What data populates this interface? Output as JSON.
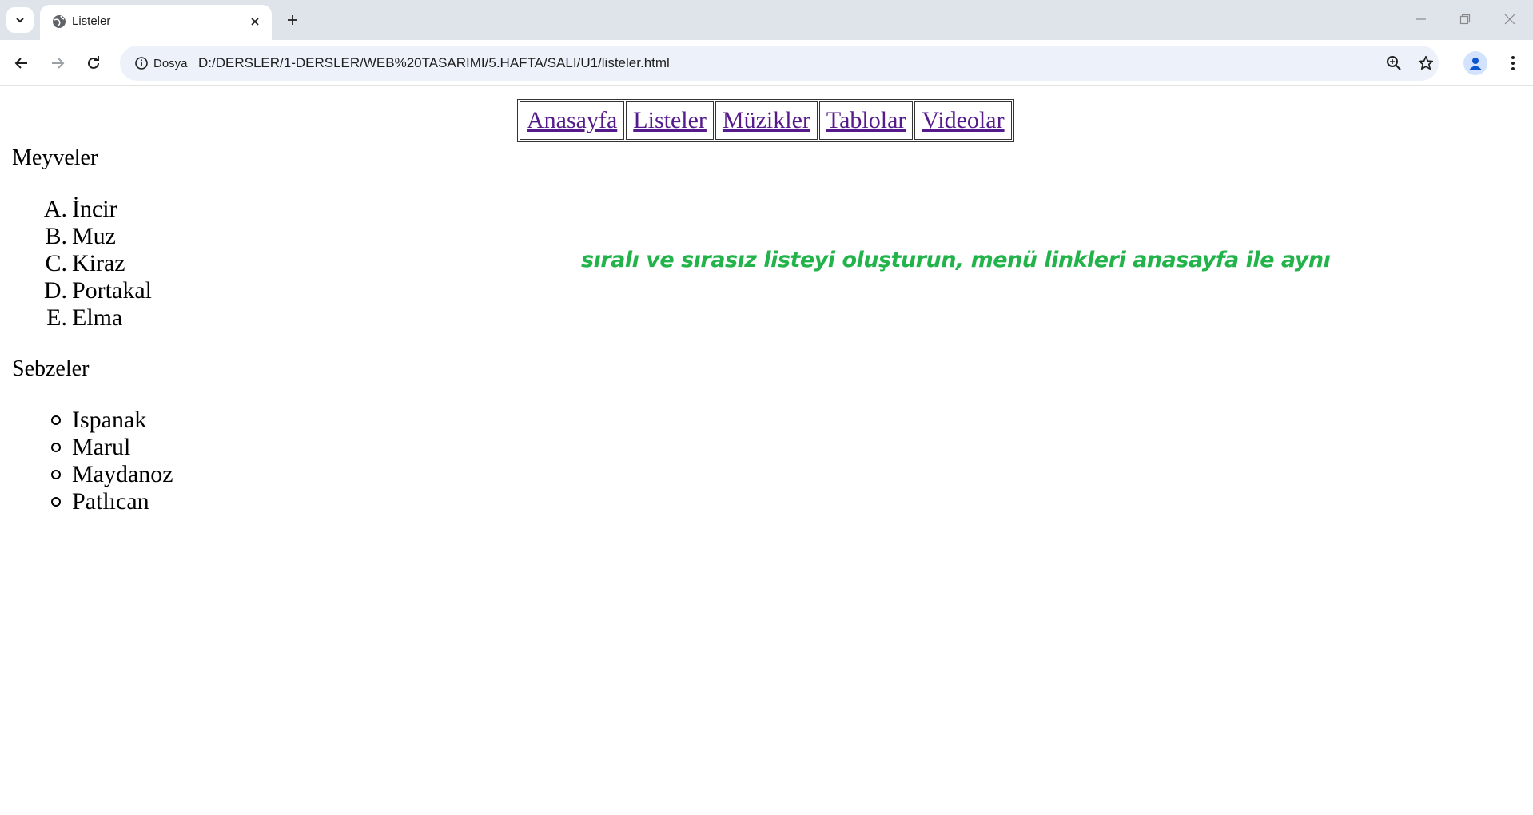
{
  "browser": {
    "tab_title": "Listeler",
    "site_info_label": "Dosya",
    "url": "D:/DERSLER/1-DERSLER/WEB%20TASARIMI/5.HAFTA/SALI/U1/listeler.html"
  },
  "page": {
    "menu": [
      "Anasayfa",
      "Listeler",
      "Müzikler",
      "Tablolar",
      "Videolar"
    ],
    "fruits": {
      "title": "Meyveler",
      "list_type": "ordered",
      "markers": [
        "A.",
        "B.",
        "C.",
        "D.",
        "E."
      ],
      "items": [
        "İncir",
        "Muz",
        "Kiraz",
        "Portakal",
        "Elma"
      ]
    },
    "vegetables": {
      "title": "Sebzeler",
      "list_type": "unordered-circle",
      "items": [
        "Ispanak",
        "Marul",
        "Maydanoz",
        "Patlıcan"
      ]
    },
    "note": "sıralı ve sırasız listeyi oluşturun, menü linkleri anasayfa ile aynı",
    "note_color": "#22b34b",
    "link_color": "#551a8b"
  }
}
